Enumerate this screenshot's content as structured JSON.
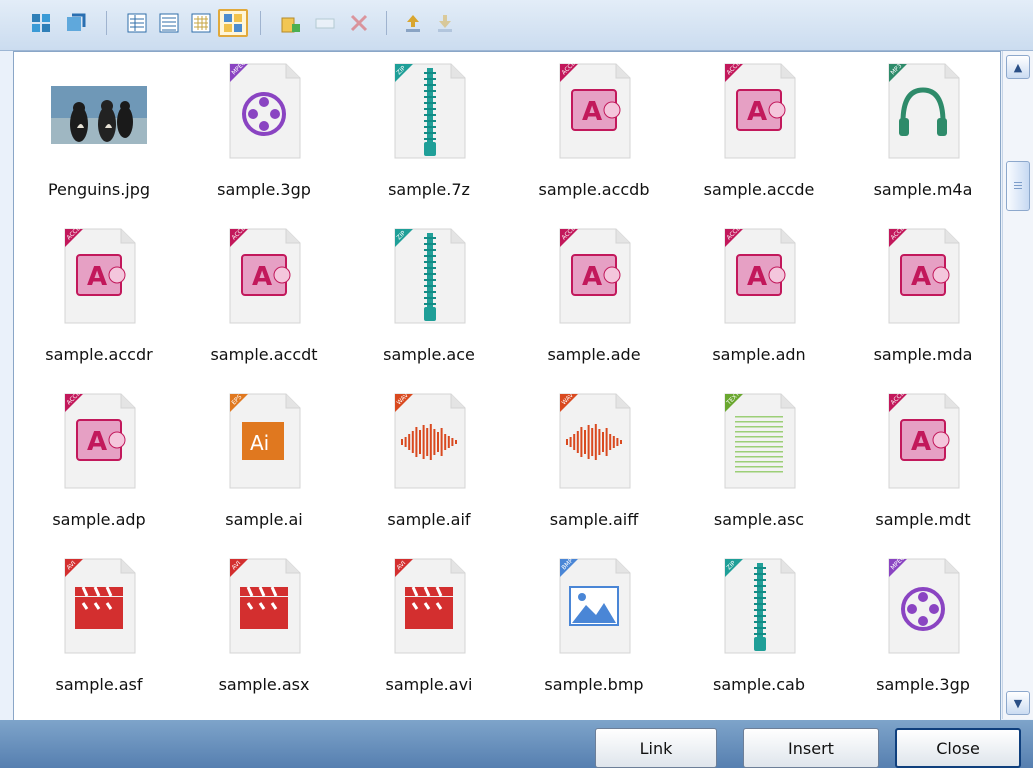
{
  "toolbar": {
    "buttons": [
      {
        "icon": "fit-icon"
      },
      {
        "icon": "refresh-icon"
      },
      {
        "icon": "details-view-icon"
      },
      {
        "icon": "list-view-icon"
      },
      {
        "icon": "small-thumbs-view-icon"
      },
      {
        "icon": "thumbnails-view-icon",
        "active": true
      },
      {
        "icon": "new-folder-icon"
      },
      {
        "icon": "rename-icon"
      },
      {
        "icon": "delete-icon"
      },
      {
        "icon": "upload-icon"
      },
      {
        "icon": "download-icon"
      }
    ]
  },
  "files": [
    {
      "name": "Penguins.jpg",
      "kind": "photo"
    },
    {
      "name": "sample.3gp",
      "kind": "mpeg",
      "badge": "MPEG",
      "color": "#8a44c2"
    },
    {
      "name": "sample.7z",
      "kind": "zip",
      "badge": "ZIP",
      "color": "#1f9f98"
    },
    {
      "name": "sample.accdb",
      "kind": "access",
      "badge": "ACCDB",
      "color": "#c2185b"
    },
    {
      "name": "sample.accde",
      "kind": "access",
      "badge": "ACCDE",
      "color": "#c2185b"
    },
    {
      "name": "sample.m4a",
      "kind": "mp3",
      "badge": "MP3",
      "color": "#2e8b6a"
    },
    {
      "name": "sample.accdr",
      "kind": "access",
      "badge": "ACCDB",
      "color": "#c2185b"
    },
    {
      "name": "sample.accdt",
      "kind": "access",
      "badge": "ACCDB",
      "color": "#c2185b"
    },
    {
      "name": "sample.ace",
      "kind": "zip",
      "badge": "ZIP",
      "color": "#1f9f98"
    },
    {
      "name": "sample.ade",
      "kind": "access",
      "badge": "ACCDB",
      "color": "#c2185b"
    },
    {
      "name": "sample.adn",
      "kind": "access",
      "badge": "ACCDB",
      "color": "#c2185b"
    },
    {
      "name": "sample.mda",
      "kind": "access",
      "badge": "ACCDB",
      "color": "#c2185b"
    },
    {
      "name": "sample.adp",
      "kind": "access",
      "badge": "ACCDB",
      "color": "#c2185b"
    },
    {
      "name": "sample.ai",
      "kind": "ai",
      "badge": "EPS",
      "color": "#e0781f"
    },
    {
      "name": "sample.aif",
      "kind": "wav",
      "badge": "WAV",
      "color": "#d9491f"
    },
    {
      "name": "sample.aiff",
      "kind": "wav",
      "badge": "WAV",
      "color": "#d9491f"
    },
    {
      "name": "sample.asc",
      "kind": "text",
      "badge": "TEXT",
      "color": "#6aa72f"
    },
    {
      "name": "sample.mdt",
      "kind": "access",
      "badge": "ACCDB",
      "color": "#c2185b"
    },
    {
      "name": "sample.asf",
      "kind": "avi",
      "badge": "AVI",
      "color": "#d32f2f"
    },
    {
      "name": "sample.asx",
      "kind": "avi",
      "badge": "AVI",
      "color": "#d32f2f"
    },
    {
      "name": "sample.avi",
      "kind": "avi",
      "badge": "AVI",
      "color": "#d32f2f"
    },
    {
      "name": "sample.bmp",
      "kind": "bmp",
      "badge": "BMP",
      "color": "#4a86d6"
    },
    {
      "name": "sample.cab",
      "kind": "zip",
      "badge": "ZIP",
      "color": "#1f9f98"
    },
    {
      "name": "sample.3gp",
      "kind": "mpeg",
      "badge": "MPEG",
      "color": "#8a44c2"
    }
  ],
  "footer": {
    "link_label": "Link",
    "insert_label": "Insert",
    "close_label": "Close"
  }
}
